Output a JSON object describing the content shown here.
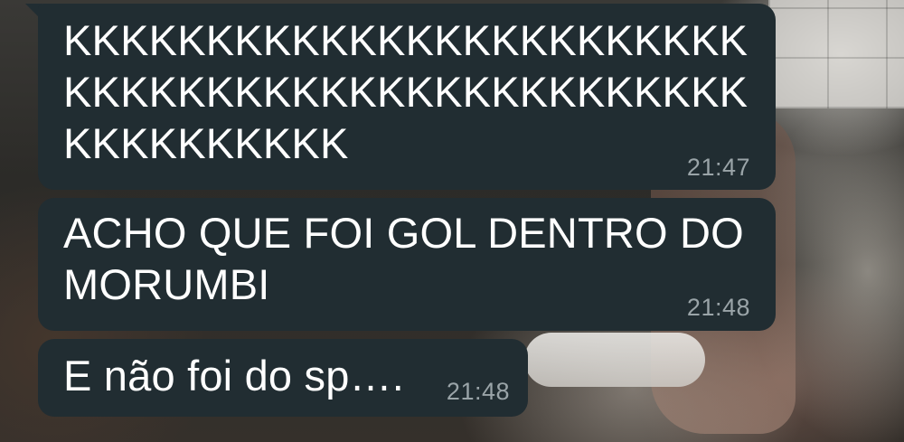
{
  "messages": [
    {
      "text": "KKKKKKKKKKKKKKKKKKKKKKKK\nKKKKKKKKKKKKKKKKKKKKKKKK\nKKKKKKKKKK",
      "time": "21:47"
    },
    {
      "text": "ACHO QUE FOI GOL DENTRO DO\nMORUMBI",
      "time": "21:48"
    },
    {
      "text": "E não foi do sp….",
      "time": "21:48"
    }
  ],
  "colors": {
    "bubble": "#212d32",
    "text": "#ffffff",
    "timestamp": "#9aa4a8"
  }
}
